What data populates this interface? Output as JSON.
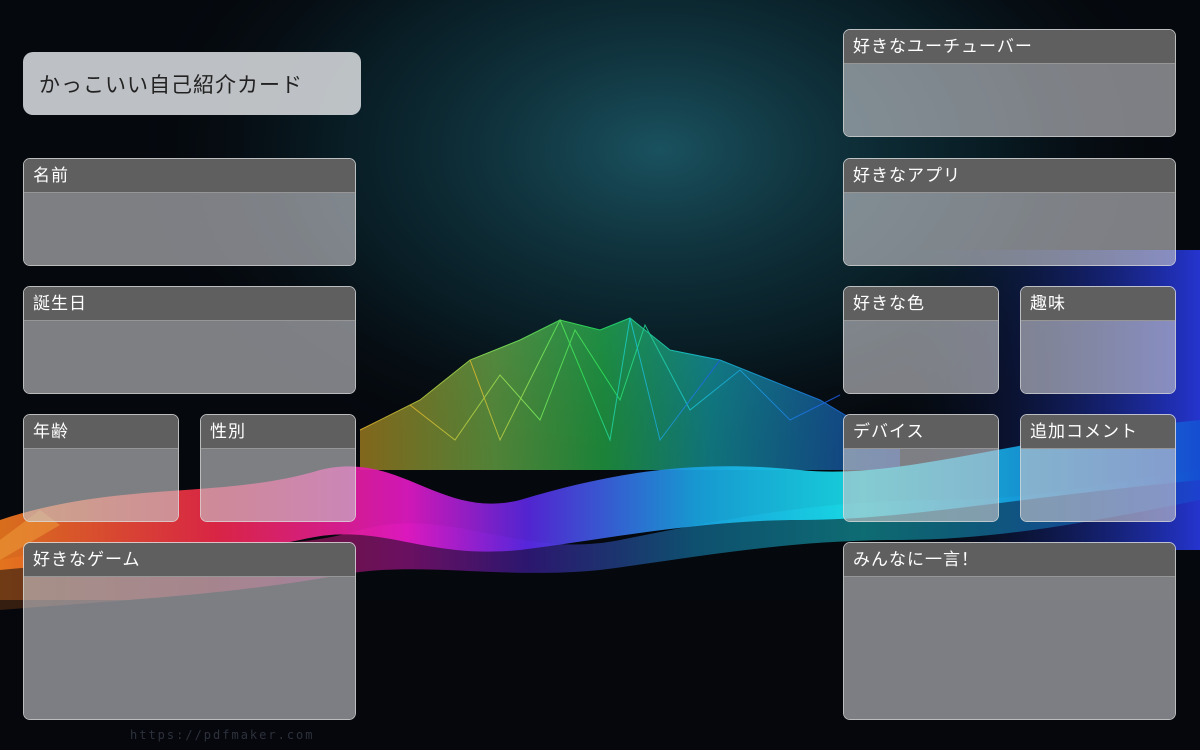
{
  "card": {
    "title": "かっこいい自己紹介カード",
    "fields": {
      "name": "名前",
      "birthday": "誕生日",
      "age": "年齢",
      "gender": "性別",
      "favorite_game": "好きなゲーム",
      "favorite_youtuber": "好きなユーチューバー",
      "favorite_app": "好きなアプリ",
      "favorite_color": "好きな色",
      "hobby": "趣味",
      "device": "デバイス",
      "additional_comment": "追加コメント",
      "message_to_all": "みんなに一言！"
    },
    "watermark": "https://pdfmaker.com"
  },
  "colors": {
    "header": "#5f5f5f",
    "field_body": "#c8c8cd",
    "background": "#05080d",
    "accent_cyan": "#19e6f0",
    "accent_magenta": "#e619c8",
    "accent_green": "#2ee65a"
  }
}
